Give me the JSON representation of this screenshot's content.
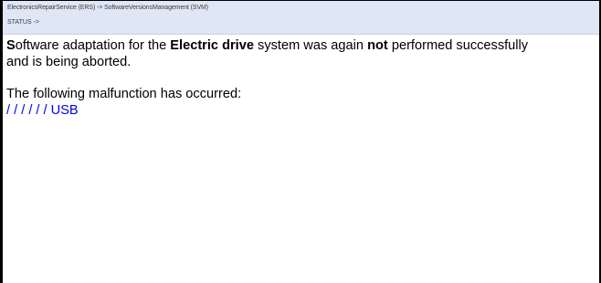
{
  "header": {
    "breadcrumb": "ElectronicsRepairService (ERS) -> SoftwareVersionsManagement (SVM)",
    "status": "STATUS ->"
  },
  "message": {
    "line1_s": "S",
    "line1_a": "oftware adaptation for the ",
    "line1_b": "Electric drive",
    "line1_c": " system was again ",
    "line1_d": "not",
    "line1_e": " performed successfully",
    "line2": "and is being aborted.",
    "malfunction_heading": "The following malfunction has occurred:",
    "malfunction_code": "/ / / / / / USB"
  },
  "colors": {
    "header_bg": "#dfe6f5",
    "link_blue": "#0000ee"
  }
}
